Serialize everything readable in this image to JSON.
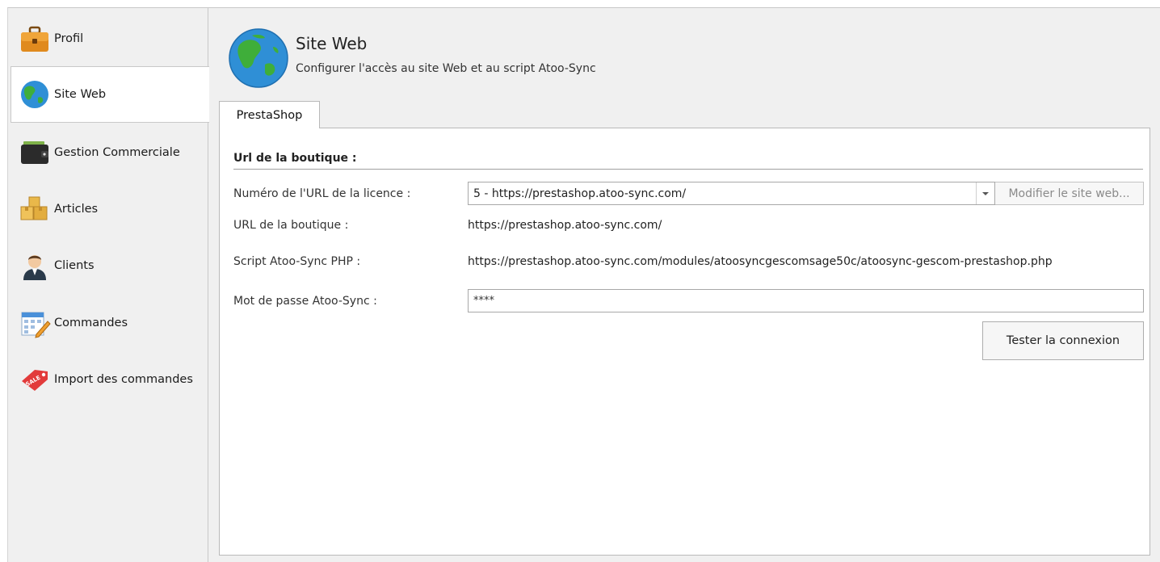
{
  "sidebar": {
    "items": [
      {
        "label": "Profil",
        "icon": "briefcase-icon",
        "active": false
      },
      {
        "label": "Site Web",
        "icon": "globe-icon",
        "active": true
      },
      {
        "label": "Gestion Commerciale",
        "icon": "wallet-icon",
        "active": false
      },
      {
        "label": "Articles",
        "icon": "boxes-icon",
        "active": false
      },
      {
        "label": "Clients",
        "icon": "user-icon",
        "active": false
      },
      {
        "label": "Commandes",
        "icon": "calendar-edit-icon",
        "active": false
      },
      {
        "label": "Import des commandes",
        "icon": "sale-tag-icon",
        "active": false
      }
    ]
  },
  "header": {
    "title": "Site Web",
    "subtitle": "Configurer l'accès au site Web et au script Atoo-Sync",
    "icon": "globe-icon"
  },
  "tabs": [
    {
      "label": "PrestaShop",
      "active": true
    }
  ],
  "form": {
    "section_title": "Url de la boutique :",
    "license_url_label": "Numéro de l'URL de la licence :",
    "license_url_value": "5 - https://prestashop.atoo-sync.com/",
    "modify_button_label": "Modifier le site web...",
    "shop_url_label": "URL de la boutique :",
    "shop_url_value": "https://prestashop.atoo-sync.com/",
    "script_label": "Script Atoo-Sync PHP :",
    "script_value": "https://prestashop.atoo-sync.com/modules/atoosyncgescomsage50c/atoosync-gescom-prestashop.php",
    "password_label": "Mot de passe Atoo-Sync :",
    "password_value": "****",
    "test_button_label": "Tester la connexion"
  },
  "colors": {
    "background": "#f0f0f0",
    "panel": "#ffffff",
    "border": "#b9b9b9",
    "globe_ocean": "#2f8fd6",
    "globe_land": "#3fae3a"
  }
}
